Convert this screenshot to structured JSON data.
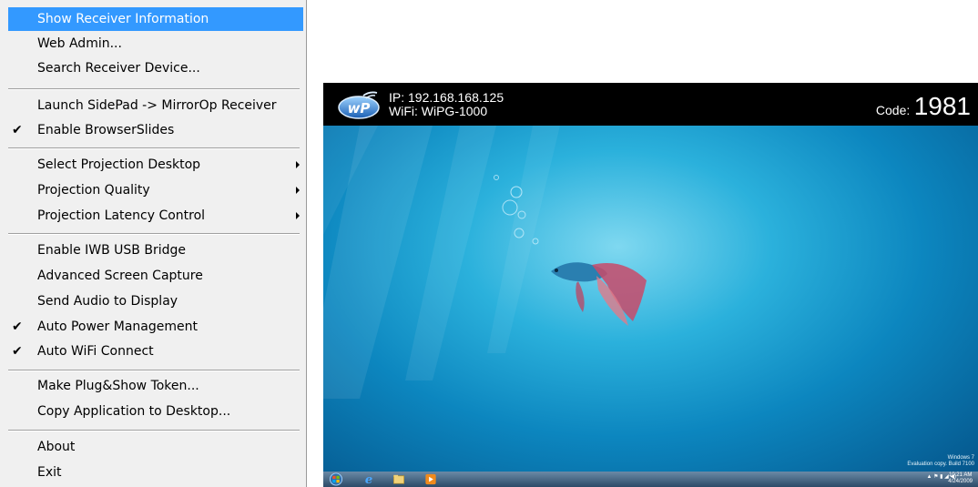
{
  "menu": {
    "items": [
      {
        "label": "Show Receiver Information",
        "highlighted": true
      },
      {
        "label": "Web Admin..."
      },
      {
        "label": "Search Receiver Device..."
      },
      {
        "label": "Launch SidePad -> MirrorOp Receiver"
      },
      {
        "label": "Enable BrowserSlides",
        "checked": true
      },
      {
        "label": "Select Projection Desktop",
        "submenu": true
      },
      {
        "label": "Projection Quality",
        "submenu": true
      },
      {
        "label": "Projection Latency Control",
        "submenu": true
      },
      {
        "label": "Enable IWB USB Bridge"
      },
      {
        "label": "Advanced Screen Capture"
      },
      {
        "label": "Send Audio to Display"
      },
      {
        "label": "Auto Power Management",
        "checked": true
      },
      {
        "label": "Auto WiFi Connect",
        "checked": true
      },
      {
        "label": "Make Plug&Show Token..."
      },
      {
        "label": "Copy Application to Desktop..."
      },
      {
        "label": "About"
      },
      {
        "label": "Exit"
      }
    ],
    "check_glyph": "✔"
  },
  "receiver": {
    "logo_text": "wP",
    "ip": "IP: 192.168.168.125",
    "wifi": "WiFi: WiPG-1000",
    "code_label": "Code:",
    "code": "1981"
  },
  "desktop": {
    "watermark_line1": "Windows 7",
    "watermark_line2": "Evaluation copy. Build 7100",
    "clock_time": "10:21 AM",
    "clock_date": "4/24/2009"
  },
  "icons": {
    "start": "windows-start-orb-icon",
    "ie": "internet-explorer-icon",
    "explorer": "folder-icon",
    "media": "media-player-icon"
  }
}
